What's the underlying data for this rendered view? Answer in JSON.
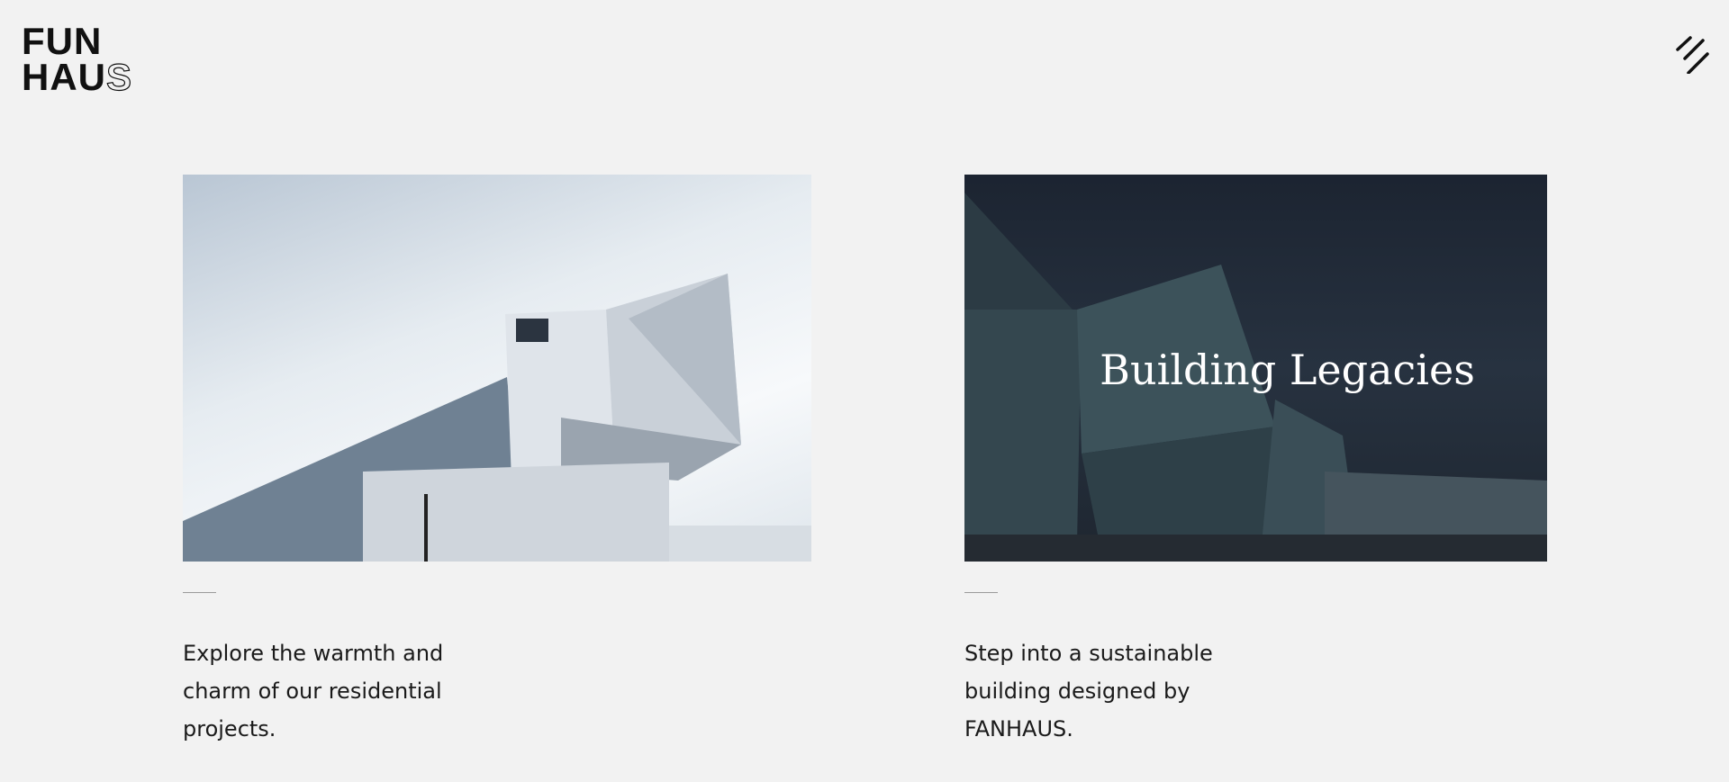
{
  "logo": {
    "line1": "FUN",
    "line2": "HAU",
    "line2_outline": "S"
  },
  "menu": {
    "icon": "menu-slashes-icon"
  },
  "cards": [
    {
      "description": "Explore the warmth and charm of our residential projects.",
      "image": "modern-building-photo"
    },
    {
      "description": "Step into a sustainable building designed by FANHAUS.",
      "image": "glass-building-photo",
      "overlay_title": "Building Legacies"
    }
  ]
}
